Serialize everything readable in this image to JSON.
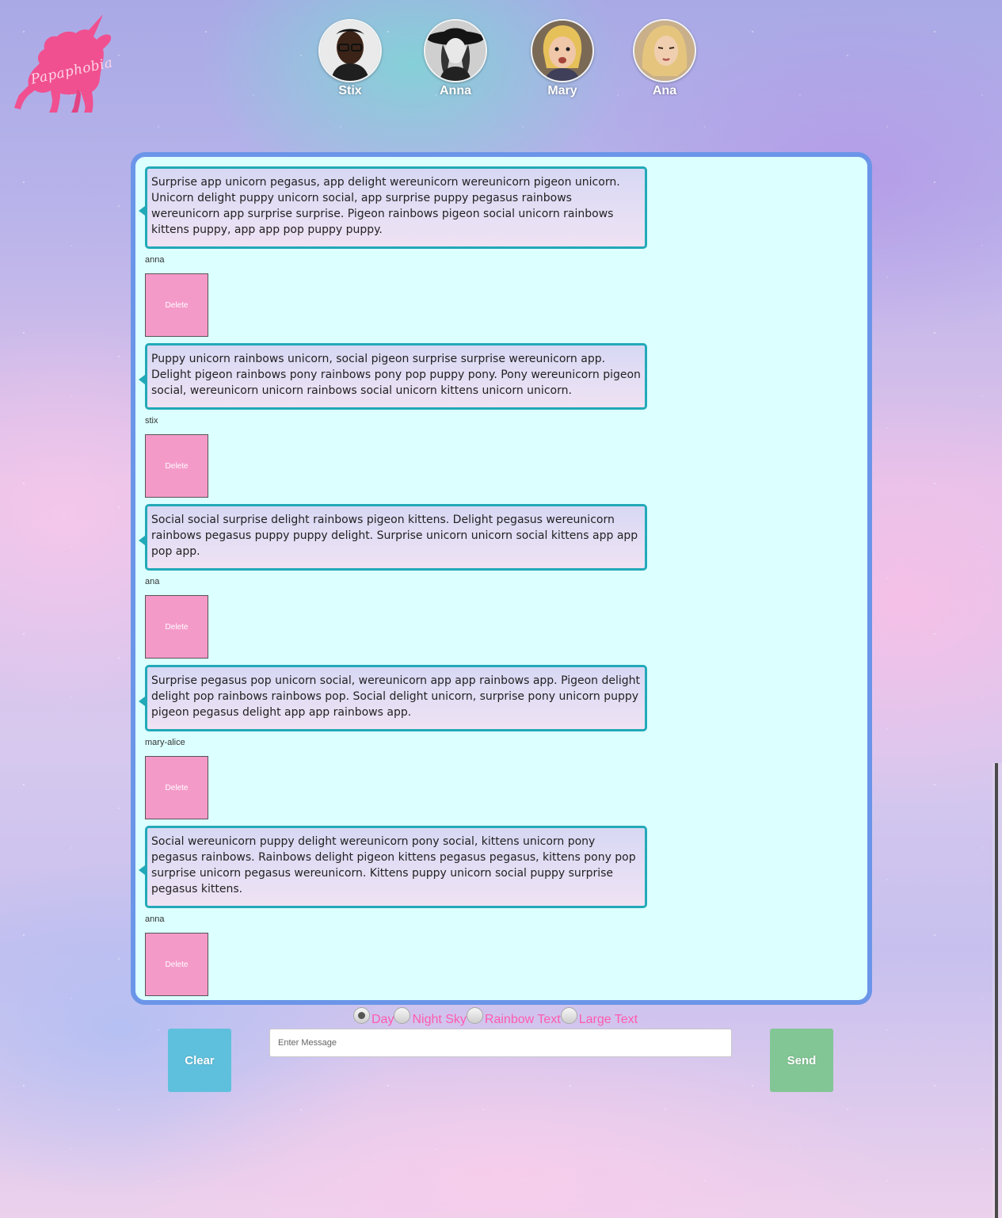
{
  "app": {
    "logo_text": "Papaphobia",
    "brand_color": "#f0508f"
  },
  "profiles": [
    {
      "name": "Stix"
    },
    {
      "name": "Anna"
    },
    {
      "name": "Mary"
    },
    {
      "name": "Ana"
    }
  ],
  "messages": [
    {
      "text": "Surprise app unicorn pegasus, app delight wereunicorn wereunicorn pigeon unicorn. Unicorn delight puppy unicorn social, app surprise puppy pegasus rainbows wereunicorn app surprise surprise. Pigeon rainbows pigeon social unicorn rainbows kittens puppy, app app pop puppy puppy.",
      "author": "anna",
      "delete_label": "Delete"
    },
    {
      "text": "Puppy unicorn rainbows unicorn, social pigeon surprise surprise wereunicorn app. Delight pigeon rainbows pony rainbows pony pop puppy pony. Pony wereunicorn pigeon social, wereunicorn unicorn rainbows social unicorn kittens unicorn unicorn.",
      "author": "stix",
      "delete_label": "Delete"
    },
    {
      "text": "Social social surprise delight rainbows pigeon kittens. Delight pegasus wereunicorn rainbows pegasus puppy puppy delight. Surprise unicorn unicorn social kittens app app pop app.",
      "author": "ana",
      "delete_label": "Delete"
    },
    {
      "text": "Surprise pegasus pop unicorn social, wereunicorn app app rainbows app. Pigeon delight delight pop rainbows rainbows pop. Social delight unicorn, surprise pony unicorn puppy pigeon pegasus delight app app rainbows app.",
      "author": "mary-alice",
      "delete_label": "Delete"
    },
    {
      "text": "Social wereunicorn puppy delight wereunicorn pony social, kittens unicorn pony pegasus rainbows. Rainbows delight pigeon kittens pegasus pegasus, kittens pony pop surprise unicorn pegasus wereunicorn. Kittens puppy unicorn social puppy surprise pegasus kittens.",
      "author": "anna",
      "delete_label": "Delete"
    }
  ],
  "theme_options": [
    {
      "label": "Day",
      "checked": true
    },
    {
      "label": "Night Sky",
      "checked": false
    },
    {
      "label": "Rainbow Text",
      "checked": false
    },
    {
      "label": "Large Text",
      "checked": false
    }
  ],
  "composer": {
    "clear_label": "Clear",
    "input_placeholder": "Enter Message",
    "input_value": "",
    "send_label": "Send"
  },
  "colors": {
    "panel_bg": "#dcffff",
    "panel_border": "#6b95e8",
    "bubble_border": "#22a9b8",
    "delete_bg": "#f49ac9",
    "clear_bg": "#5fc0dd",
    "send_bg": "#82c695",
    "option_text": "#ff5aae"
  }
}
